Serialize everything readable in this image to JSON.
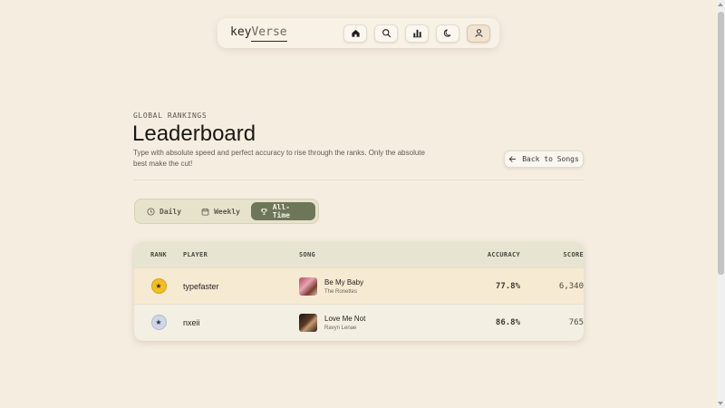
{
  "nav": {
    "logo_a": "key",
    "logo_b": "Verse",
    "buttons": [
      {
        "icon": "home-icon",
        "active": false
      },
      {
        "icon": "search-icon",
        "active": false
      },
      {
        "icon": "bar-chart-icon",
        "active": false
      },
      {
        "icon": "moon-icon",
        "active": false
      },
      {
        "icon": "user-icon",
        "active": true
      }
    ]
  },
  "header": {
    "eyebrow": "GLOBAL RANKINGS",
    "title": "Leaderboard",
    "description": "Type with absolute speed and perfect accuracy to rise through the ranks. Only the absolute best make the cut!",
    "back_label": "Back to Songs"
  },
  "tabs": [
    {
      "label": "Daily",
      "icon": "clock-icon",
      "active": false
    },
    {
      "label": "Weekly",
      "icon": "calendar-icon",
      "active": false
    },
    {
      "label": "All-Time",
      "icon": "trophy-icon",
      "active": true
    }
  ],
  "table": {
    "columns": {
      "rank": "RANK",
      "player": "PLAYER",
      "song": "SONG",
      "accuracy": "ACCURACY",
      "score": "SCORE"
    },
    "rows": [
      {
        "badge": "★",
        "player": "typefaster",
        "song": "Be My Baby",
        "artist": "The Ronettes",
        "accuracy": "77.8%",
        "score": "6,340"
      },
      {
        "badge": "★",
        "player": "nxeii",
        "song": "Love Me Not",
        "artist": "Ravyn Lenae",
        "accuracy": "86.8%",
        "score": "765"
      }
    ]
  },
  "colors": {
    "background": "#f5ede0",
    "accent": "#6d7659",
    "gold": "#f2c024",
    "silver": "#cfd6e6"
  }
}
